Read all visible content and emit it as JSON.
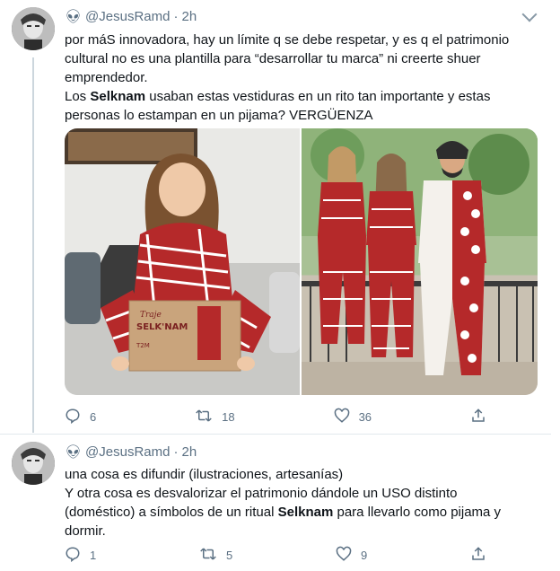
{
  "tweets": [
    {
      "handle": "@JesusRamd",
      "dot": "·",
      "time": "2h",
      "lines": [
        "por máS innovadora, hay un límite q se debe respetar, y es q el patrimonio",
        "cultural no es una plantilla para “desarrollar tu marca” ni creerte shuer",
        "emprendedor."
      ],
      "line4_pre": "Los ",
      "line4_bold": "Selknam",
      "line4_post": " usaban estas vestiduras en un rito tan importante y estas",
      "line5": "personas lo estampan en un pijama? VERGÜENZA",
      "box_brand_top": "Traje",
      "box_brand": "SELK'NAM",
      "box_size": "T2M",
      "counts": {
        "replies": "6",
        "retweets": "18",
        "likes": "36"
      }
    },
    {
      "handle": "@JesusRamd",
      "dot": "·",
      "time": "2h",
      "line1": "una cosa es difundir (ilustraciones, artesanías)",
      "line2": "Y otra cosa es desvalorizar el patrimonio dándole un USO distinto",
      "line3_pre": "(doméstico) a símbolos de un ritual ",
      "line3_bold": "Selknam",
      "line3_post": " para llevarlo como pijama y",
      "line4": "dormir.",
      "counts": {
        "replies": "1",
        "retweets": "5",
        "likes": "9"
      }
    }
  ],
  "icons": {
    "alien": "alien-icon",
    "reply": "reply-icon",
    "retweet": "retweet-icon",
    "like": "heart-icon",
    "share": "share-icon",
    "chevron": "chevron-down-icon"
  },
  "colors": {
    "text": "#0f1419",
    "secondary": "#5b7083",
    "pajama_red": "#b5292a",
    "thread_line": "#ccd6dd"
  }
}
